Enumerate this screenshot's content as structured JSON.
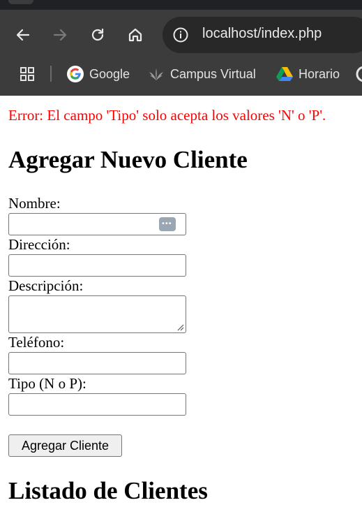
{
  "browser": {
    "url": "localhost/index.php",
    "bookmarks": [
      {
        "label": "Google",
        "icon": "google-icon"
      },
      {
        "label": "Campus Virtual",
        "icon": "campus-virtual-icon"
      },
      {
        "label": "Horario",
        "icon": "google-drive-icon"
      }
    ]
  },
  "page": {
    "error": "Error: El campo 'Tipo' solo acepta los valores 'N' o 'P'.",
    "form_title": "Agregar Nuevo Cliente",
    "fields": {
      "nombre": {
        "label": "Nombre:",
        "value": ""
      },
      "direccion": {
        "label": "Dirección:",
        "value": ""
      },
      "descripcion": {
        "label": "Descripción:",
        "value": ""
      },
      "telefono": {
        "label": "Teléfono:",
        "value": ""
      },
      "tipo": {
        "label": "Tipo (N o P):",
        "value": ""
      }
    },
    "submit_label": "Agregar Cliente",
    "list_title": "Listado de Clientes"
  },
  "colors": {
    "error": "#ff0000",
    "chrome_toolbar": "#3c3c3c",
    "omnibox": "#282828"
  }
}
